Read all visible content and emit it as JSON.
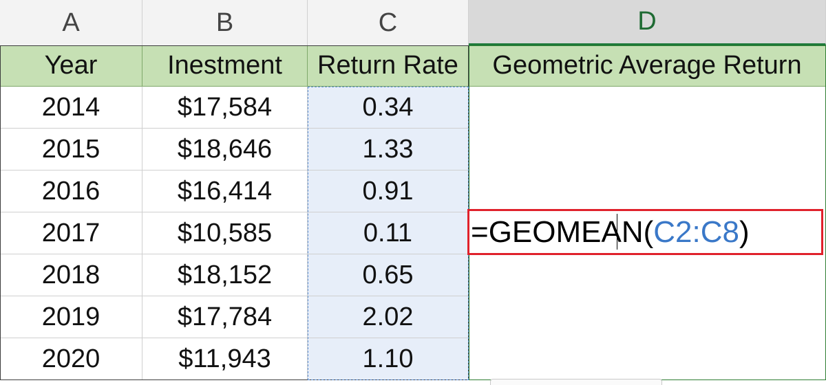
{
  "columns": [
    "A",
    "B",
    "C",
    "D"
  ],
  "headers": [
    "Year",
    "Inestment",
    "Return Rate",
    "Geometric Average Return"
  ],
  "rows": [
    [
      "2014",
      "$17,584",
      "0.34"
    ],
    [
      "2015",
      "$18,646",
      "1.33"
    ],
    [
      "2016",
      "$16,414",
      "0.91"
    ],
    [
      "2017",
      "$10,585",
      "0.11"
    ],
    [
      "2018",
      "$18,152",
      "0.65"
    ],
    [
      "2019",
      "$17,784",
      "2.02"
    ],
    [
      "2020",
      "$11,943",
      "1.10"
    ]
  ],
  "formula": {
    "prefix": "=GEOMEAN(",
    "range": "C2:C8",
    "suffix": ")"
  }
}
